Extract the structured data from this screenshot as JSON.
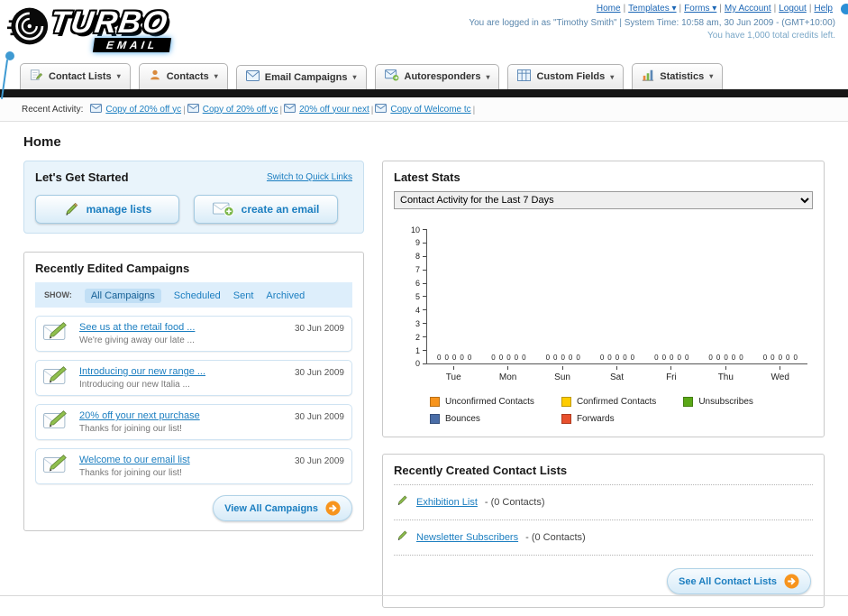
{
  "header": {
    "logo_line1": "TURBO",
    "logo_line2": "EMAIL",
    "nav_links": [
      {
        "label": "Home",
        "dropdown": false
      },
      {
        "label": "Templates",
        "dropdown": true
      },
      {
        "label": "Forms",
        "dropdown": true
      },
      {
        "label": "My Account",
        "dropdown": false
      },
      {
        "label": "Logout",
        "dropdown": false
      },
      {
        "label": "Help",
        "dropdown": false
      }
    ],
    "login_info": "You are logged in as \"Timothy Smith\" | System Time: 10:58 am, 30 Jun 2009 - (GMT+10:00)",
    "credits_info": "You have 1,000 total credits left."
  },
  "main_nav": [
    {
      "label": "Contact Lists",
      "icon": "list-pencil-icon"
    },
    {
      "label": "Contacts",
      "icon": "person-icon"
    },
    {
      "label": "Email Campaigns",
      "icon": "envelope-icon"
    },
    {
      "label": "Autoresponders",
      "icon": "autoresponder-icon"
    },
    {
      "label": "Custom Fields",
      "icon": "custom-fields-icon"
    },
    {
      "label": "Statistics",
      "icon": "statistics-icon"
    }
  ],
  "recent_activity": {
    "label": "Recent Activity:",
    "items": [
      "Copy of 20% off yc",
      "Copy of 20% off yc",
      "20% off your next",
      "Copy of Welcome tc"
    ]
  },
  "page_title": "Home",
  "get_started": {
    "title": "Let's Get Started",
    "switch_link": "Switch to Quick Links",
    "buttons": [
      {
        "label": "manage lists",
        "icon": "pencil-icon"
      },
      {
        "label": "create an email",
        "icon": "envelope-plus-icon"
      }
    ]
  },
  "campaigns": {
    "title": "Recently Edited Campaigns",
    "show_label": "SHOW:",
    "tabs": [
      "All Campaigns",
      "Scheduled",
      "Sent",
      "Archived"
    ],
    "active_tab": "All Campaigns",
    "rows": [
      {
        "title": "See us at the retail food ...",
        "subtitle": "We're giving away our late ...",
        "date": "30 Jun 2009"
      },
      {
        "title": "Introducing our new range ...",
        "subtitle": "Introducing our new Italia ...",
        "date": "30 Jun 2009"
      },
      {
        "title": "20% off your next purchase",
        "subtitle": "Thanks for joining our list!",
        "date": "30 Jun 2009"
      },
      {
        "title": "Welcome to our email list",
        "subtitle": "Thanks for joining our list!",
        "date": "30 Jun 2009"
      }
    ],
    "view_all_label": "View All Campaigns"
  },
  "stats": {
    "title": "Latest Stats",
    "dropdown_value": "Contact Activity for the Last 7 Days",
    "chart_data": {
      "type": "bar",
      "title": "Contact Activity for the Last 7 Days",
      "categories": [
        "Tue",
        "Mon",
        "Sun",
        "Sat",
        "Fri",
        "Thu",
        "Wed"
      ],
      "series": [
        {
          "name": "Unconfirmed Contacts",
          "color": "#f7941d",
          "values": [
            0,
            0,
            0,
            0,
            0,
            0,
            0
          ]
        },
        {
          "name": "Confirmed Contacts",
          "color": "#ffcc00",
          "values": [
            0,
            0,
            0,
            0,
            0,
            0,
            0
          ]
        },
        {
          "name": "Unsubscribes",
          "color": "#5aa817",
          "values": [
            0,
            0,
            0,
            0,
            0,
            0,
            0
          ]
        },
        {
          "name": "Bounces",
          "color": "#4a6da7",
          "values": [
            0,
            0,
            0,
            0,
            0,
            0,
            0
          ]
        },
        {
          "name": "Forwards",
          "color": "#e8502d",
          "values": [
            0,
            0,
            0,
            0,
            0,
            0,
            0
          ]
        }
      ],
      "ylim": [
        0,
        10
      ],
      "yticks": [
        0,
        1,
        2,
        3,
        4,
        5,
        6,
        7,
        8,
        9,
        10
      ],
      "grid": false,
      "legend_position": "bottom"
    }
  },
  "contact_lists": {
    "title": "Recently Created Contact Lists",
    "items": [
      {
        "name": "Exhibition List",
        "detail": "- (0 Contacts)"
      },
      {
        "name": "Newsletter Subscribers",
        "detail": "- (0 Contacts)"
      }
    ],
    "see_all_label": "See All Contact Lists"
  }
}
